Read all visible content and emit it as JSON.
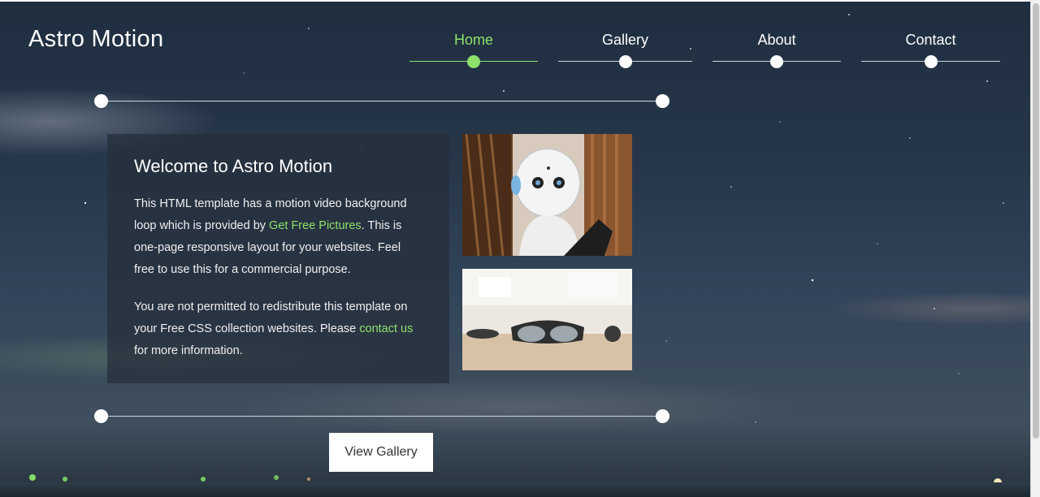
{
  "brand": {
    "title": "Astro Motion"
  },
  "nav": {
    "items": [
      {
        "label": "Home",
        "active": true
      },
      {
        "label": "Gallery",
        "active": false
      },
      {
        "label": "About",
        "active": false
      },
      {
        "label": "Contact",
        "active": false
      }
    ]
  },
  "welcome": {
    "heading": "Welcome to Astro Motion",
    "p1_before": "This HTML template has a motion video background loop which is provided by ",
    "p1_link": "Get Free Pictures",
    "p1_after": ". This is one-page responsive layout for your websites. Feel free to use this for a commercial purpose.",
    "p2_before": "You are not permitted to redistribute this template on your Free CSS collection websites. Please ",
    "p2_link": "contact us",
    "p2_after": " for more information."
  },
  "images": {
    "robot": "robot-photo",
    "glasses": "ar-glasses-photo"
  },
  "cta": {
    "label": "View Gallery"
  },
  "colors": {
    "accent": "#8ee26a",
    "panel": "#26303c",
    "sky": "#27384b"
  }
}
